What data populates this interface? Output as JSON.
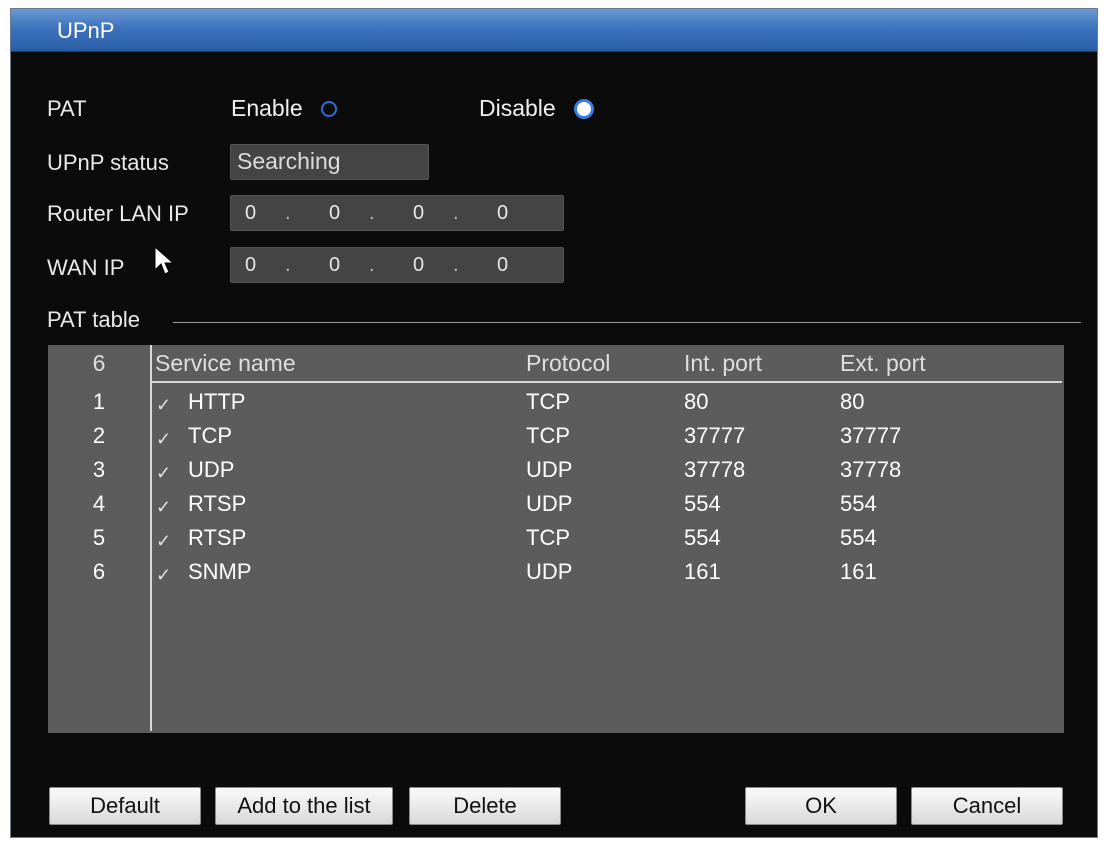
{
  "window": {
    "title": "UPnP"
  },
  "pat": {
    "label": "PAT",
    "enable_label": "Enable",
    "disable_label": "Disable",
    "selected": "Disable"
  },
  "upnp_status": {
    "label": "UPnP status",
    "value": "Searching"
  },
  "router_lan_ip": {
    "label": "Router LAN IP",
    "octets": [
      "0",
      "0",
      "0",
      "0"
    ]
  },
  "wan_ip": {
    "label": "WAN IP",
    "octets": [
      "0",
      "0",
      "0",
      "0"
    ]
  },
  "pat_table": {
    "label": "PAT table",
    "headers": {
      "count": "6",
      "service": "Service name",
      "protocol": "Protocol",
      "int_port": "Int. port",
      "ext_port": "Ext. port"
    },
    "rows": [
      {
        "idx": "1",
        "checked": true,
        "service": "HTTP",
        "protocol": "TCP",
        "int_port": "80",
        "ext_port": "80"
      },
      {
        "idx": "2",
        "checked": true,
        "service": "TCP",
        "protocol": "TCP",
        "int_port": "37777",
        "ext_port": "37777"
      },
      {
        "idx": "3",
        "checked": true,
        "service": "UDP",
        "protocol": "UDP",
        "int_port": "37778",
        "ext_port": "37778"
      },
      {
        "idx": "4",
        "checked": true,
        "service": "RTSP",
        "protocol": "UDP",
        "int_port": "554",
        "ext_port": "554"
      },
      {
        "idx": "5",
        "checked": true,
        "service": "RTSP",
        "protocol": "TCP",
        "int_port": "554",
        "ext_port": "554"
      },
      {
        "idx": "6",
        "checked": true,
        "service": "SNMP",
        "protocol": "UDP",
        "int_port": "161",
        "ext_port": "161"
      }
    ]
  },
  "buttons": {
    "default": "Default",
    "add": "Add to the list",
    "delete": "Delete",
    "ok": "OK",
    "cancel": "Cancel"
  },
  "colors": {
    "titlebar": "#3d73bc",
    "background": "#0b0b0b",
    "table": "#5c5c5c",
    "accent": "#2d6fd6"
  }
}
